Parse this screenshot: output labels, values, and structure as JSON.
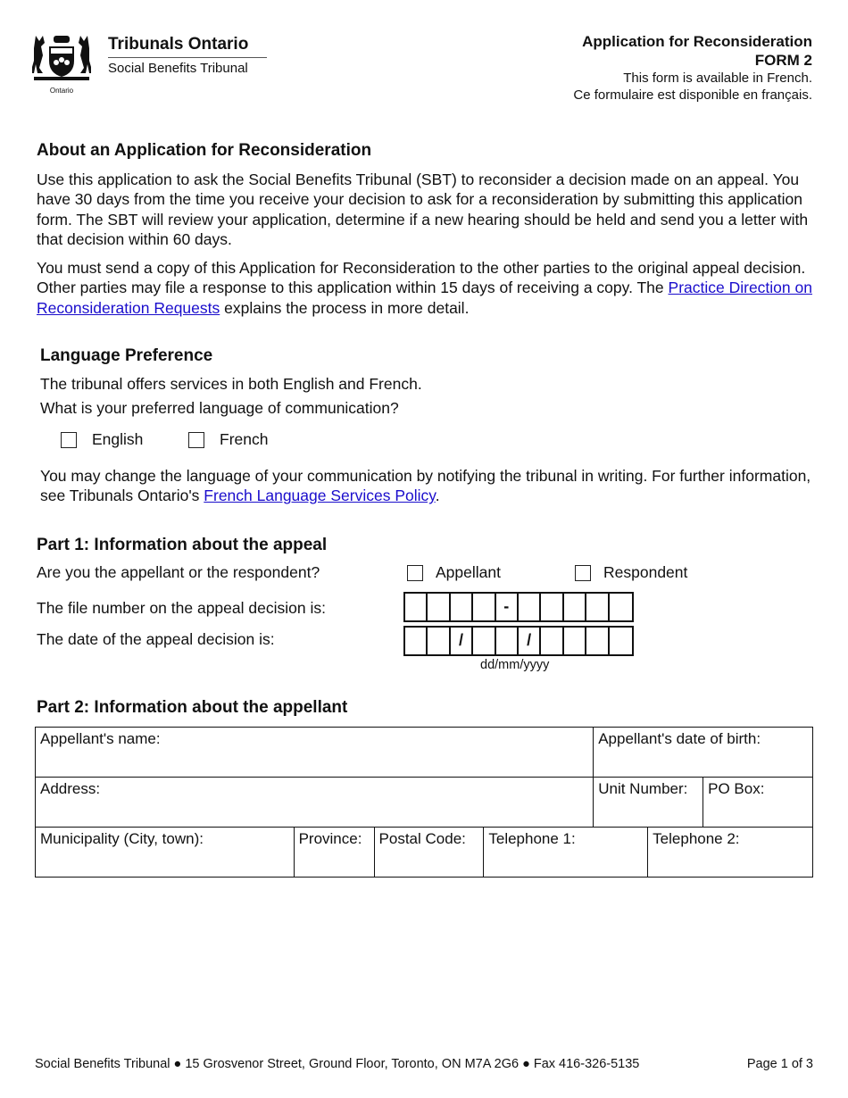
{
  "header": {
    "logo_caption": "Ontario",
    "org_name": "Tribunals Ontario",
    "org_sub": "Social Benefits Tribunal",
    "form_title": "Application for Reconsideration",
    "form_number": "FORM 2",
    "available_en": "This form is available in French.",
    "available_fr": "Ce formulaire est disponible en français."
  },
  "about": {
    "heading": "About an Application for Reconsideration",
    "para1": "Use this application to ask the Social Benefits Tribunal (SBT) to reconsider a decision made on an appeal. You have 30 days from the time you receive your decision to ask for a reconsideration by submitting this application form. The SBT will review your application, determine if a new hearing should be held and send you a letter with that decision within 60 days.",
    "para2_before": "You must send a copy of this Application for Reconsideration to the other parties to the original appeal decision. Other parties may file a response to this application within 15 days of receiving a copy. The ",
    "para2_link": "Practice Direction on Reconsideration Requests",
    "para2_after": " explains the process in more detail."
  },
  "language": {
    "heading": "Language Preference",
    "line1": "The tribunal offers services in both English and French.",
    "line2": "What is your preferred language of communication?",
    "options": [
      "English",
      "French"
    ],
    "note_before": "You may change the language of your communication by notifying the tribunal in writing.  For further information, see Tribunals Ontario's ",
    "note_link": "French Language Services Policy",
    "note_after": "."
  },
  "part1": {
    "heading": "Part 1:  Information about the appeal",
    "role_question": "Are you the appellant or the respondent?",
    "role_options": [
      "Appellant",
      "Respondent"
    ],
    "file_label": "The file number on the appeal decision is:",
    "file_cells": [
      "",
      "",
      "",
      "",
      "-",
      "",
      "",
      "",
      "",
      ""
    ],
    "date_label": "The date of the appeal decision is:",
    "date_cells": [
      "",
      "",
      "/",
      "",
      "",
      "/",
      "",
      "",
      "",
      ""
    ],
    "date_format": "dd/mm/yyyy"
  },
  "part2": {
    "heading": "Part 2:  Information about the appellant",
    "fields": {
      "name": "Appellant's name:",
      "dob": "Appellant's date of birth:",
      "address": "Address:",
      "unit": "Unit Number:",
      "pobox": "PO Box:",
      "municipality": "Municipality (City, town):",
      "province": "Province:",
      "postal": "Postal Code:",
      "tel1": "Telephone 1:",
      "tel2": "Telephone 2:"
    }
  },
  "footer": {
    "address": "Social Benefits Tribunal  ●  15 Grosvenor Street, Ground Floor, Toronto, ON  M7A 2G6  ●  Fax 416-326-5135",
    "page": "Page 1 of 3"
  }
}
